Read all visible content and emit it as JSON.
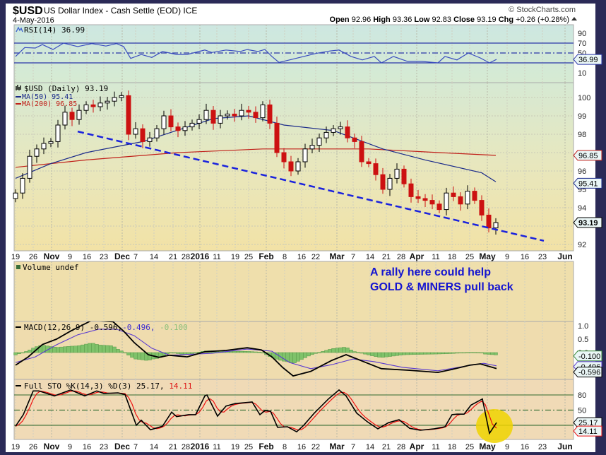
{
  "header": {
    "symbol": "$USD",
    "name": "US Dollar Index - Cash Settle (EOD) ICE",
    "date": "4-May-2016",
    "watermark": "© StockCharts.com",
    "open_label": "Open",
    "open": "92.96",
    "high_label": "High",
    "high": "93.36",
    "low_label": "Low",
    "low": "92.83",
    "close_label": "Close",
    "close": "93.19",
    "chg_label": "Chg",
    "chg": "+0.26 (+0.28%)"
  },
  "panels": {
    "rsi": {
      "label": "RSI(14) 36.99",
      "tag": "36.99"
    },
    "price": {
      "label": "$USD (Daily) 93.19",
      "ma50_label": "MA(50) 95.41",
      "ma200_label": "MA(200) 96.85",
      "close_tag": "93.19",
      "ma50_tag": "95.41",
      "ma200_tag": "96.85"
    },
    "volume": {
      "label": "Volume undef"
    },
    "macd": {
      "label": "MACD(12,26,9) -0.596,",
      "signal": "-0.496,",
      "hist": "-0.100",
      "tags": [
        "-0.100",
        "-0.496",
        "-0.596"
      ]
    },
    "sto": {
      "label": "Full STO %K(14,3) %D(3) 25.17,",
      "d": "14.11",
      "tags": [
        "25.17",
        "14.11"
      ]
    }
  },
  "annotation": {
    "line1": "A rally here could help",
    "line2": "GOLD & MINERS pull back"
  },
  "colors": {
    "frame": "#2b2a57",
    "up": "#000000",
    "down": "#cc1111",
    "ma50": "#1a2a8a",
    "ma200": "#c0201a",
    "trend": "#1a22dd",
    "rsi": "#3a4cc0",
    "macd_hist": "#7fc26a",
    "macd_signal": "#5a3ad0",
    "sto_d": "#ee1111",
    "highlight": "#f0d400",
    "annotation": "#1515d0"
  },
  "chart_data": {
    "type": "candlestick",
    "title": "$USD US Dollar Index - Cash Settle (EOD) ICE",
    "x_unit": "2-trading-day steps from 19-Oct-2015",
    "x_ticks": [
      {
        "k": 0,
        "label": "19"
      },
      {
        "k": 2.5,
        "label": "26"
      },
      {
        "k": 5.1,
        "label": "Nov",
        "major": true
      },
      {
        "k": 7.7,
        "label": "9"
      },
      {
        "k": 10.1,
        "label": "16"
      },
      {
        "k": 12.5,
        "label": "23"
      },
      {
        "k": 15.1,
        "label": "Dec",
        "major": true
      },
      {
        "k": 17,
        "label": "7"
      },
      {
        "k": 19.6,
        "label": "14"
      },
      {
        "k": 22.3,
        "label": "21"
      },
      {
        "k": 24.1,
        "label": "28"
      },
      {
        "k": 26.1,
        "label": "2016",
        "major": true
      },
      {
        "k": 28.5,
        "label": "11"
      },
      {
        "k": 31.1,
        "label": "19"
      },
      {
        "k": 33,
        "label": "25"
      },
      {
        "k": 35.5,
        "label": "Feb",
        "major": true
      },
      {
        "k": 38.1,
        "label": "8"
      },
      {
        "k": 40.5,
        "label": "16"
      },
      {
        "k": 42.5,
        "label": "22"
      },
      {
        "k": 45.5,
        "label": "Mar",
        "major": true
      },
      {
        "k": 47.8,
        "label": "7"
      },
      {
        "k": 50.2,
        "label": "14"
      },
      {
        "k": 52.5,
        "label": "21"
      },
      {
        "k": 54.6,
        "label": "28"
      },
      {
        "k": 56.8,
        "label": "Apr",
        "major": true
      },
      {
        "k": 59.5,
        "label": "11"
      },
      {
        "k": 61.8,
        "label": "18"
      },
      {
        "k": 64.3,
        "label": "25"
      },
      {
        "k": 66.8,
        "label": "May",
        "major": true
      },
      {
        "k": 69.6,
        "label": "9"
      },
      {
        "k": 72.1,
        "label": "16"
      },
      {
        "k": 74.6,
        "label": "23"
      },
      {
        "k": 77.8,
        "label": "Jun",
        "major": true
      }
    ],
    "price": {
      "ylim": [
        91.6,
        100.8
      ],
      "y_ticks": [
        92,
        94,
        95,
        96,
        98,
        99,
        100
      ],
      "closes": [
        94.8,
        95.6,
        96.8,
        97.2,
        97.5,
        97.6,
        98.5,
        99.2,
        98.8,
        99.3,
        99.6,
        99.5,
        99.7,
        99.8,
        100.0,
        100.1,
        98.0,
        98.3,
        97.6,
        97.8,
        98.3,
        99.0,
        98.4,
        98.2,
        98.4,
        98.6,
        98.8,
        99.3,
        98.6,
        99.0,
        99.1,
        99.0,
        99.3,
        99.2,
        98.9,
        99.6,
        98.6,
        97.0,
        96.5,
        96.0,
        96.5,
        97.2,
        97.4,
        97.8,
        98.1,
        98.3,
        98.4,
        97.8,
        97.6,
        96.5,
        96.4,
        95.8,
        95.0,
        95.6,
        96.1,
        95.3,
        94.6,
        94.5,
        94.4,
        94.2,
        93.9,
        94.8,
        94.6,
        94.2,
        94.9,
        94.4,
        93.6,
        92.9,
        93.19
      ],
      "ma50": [
        [
          0,
          95.6
        ],
        [
          5,
          96.4
        ],
        [
          10,
          97.0
        ],
        [
          18,
          97.6
        ],
        [
          28,
          98.85
        ],
        [
          33,
          99.0
        ],
        [
          38,
          98.5
        ],
        [
          45,
          98.2
        ],
        [
          52,
          97.2
        ],
        [
          58,
          96.6
        ],
        [
          66,
          95.9
        ],
        [
          68,
          95.41
        ]
      ],
      "ma200": [
        [
          0,
          96.2
        ],
        [
          10,
          96.6
        ],
        [
          23,
          97.0
        ],
        [
          35,
          97.2
        ],
        [
          50,
          97.2
        ],
        [
          60,
          97.0
        ],
        [
          68,
          96.85
        ]
      ],
      "trendline": [
        [
          8.8,
          98.15
        ],
        [
          74.8,
          92.2
        ]
      ]
    },
    "rsi": {
      "ylim": [
        0,
        100
      ],
      "levels": [
        70,
        50,
        30
      ],
      "y_ticks": [
        90,
        70,
        50,
        10
      ],
      "points": [
        [
          0,
          43
        ],
        [
          1.3,
          61
        ],
        [
          2.8,
          60
        ],
        [
          3.8,
          67
        ],
        [
          5.3,
          57
        ],
        [
          6.8,
          70
        ],
        [
          8.8,
          63
        ],
        [
          10.8,
          69
        ],
        [
          12.8,
          64
        ],
        [
          14.3,
          69
        ],
        [
          15.3,
          63
        ],
        [
          16.3,
          39
        ],
        [
          17.8,
          47
        ],
        [
          19.3,
          41
        ],
        [
          20.8,
          53
        ],
        [
          22.8,
          47
        ],
        [
          24.3,
          47
        ],
        [
          26.8,
          56
        ],
        [
          27.8,
          51
        ],
        [
          29.8,
          56
        ],
        [
          31.8,
          53
        ],
        [
          32.8,
          57
        ],
        [
          34.3,
          53
        ],
        [
          35.3,
          57
        ],
        [
          36.3,
          43
        ],
        [
          37.3,
          31
        ],
        [
          38.8,
          36
        ],
        [
          40.8,
          43
        ],
        [
          42.5,
          49
        ],
        [
          44.5,
          54
        ],
        [
          45.8,
          56
        ],
        [
          47.5,
          43
        ],
        [
          49.1,
          36
        ],
        [
          50.8,
          43
        ],
        [
          51.8,
          30
        ],
        [
          53.5,
          43
        ],
        [
          55.5,
          33
        ],
        [
          57.5,
          33
        ],
        [
          59.8,
          30
        ],
        [
          60.8,
          43
        ],
        [
          62.5,
          36
        ],
        [
          64.1,
          50
        ],
        [
          65.8,
          40
        ],
        [
          67.1,
          30
        ],
        [
          68.1,
          36.99
        ]
      ]
    },
    "macd": {
      "ylim": [
        -1.0,
        1.2
      ],
      "y_ticks": [
        1.0,
        0.5,
        0.0
      ],
      "macd": [
        [
          0,
          -0.47
        ],
        [
          1.8,
          -0.16
        ],
        [
          3.8,
          0.3
        ],
        [
          5.8,
          0.5
        ],
        [
          7.8,
          0.8
        ],
        [
          10.8,
          1.2
        ],
        [
          13.8,
          1.15
        ],
        [
          15.3,
          0.8
        ],
        [
          16.8,
          0.37
        ],
        [
          18.8,
          -0.08
        ],
        [
          20.3,
          -0.18
        ],
        [
          21.8,
          -0.1
        ],
        [
          24.3,
          -0.16
        ],
        [
          26.8,
          0.03
        ],
        [
          29.8,
          0.08
        ],
        [
          32.8,
          0.18
        ],
        [
          34.8,
          0.1
        ],
        [
          36.3,
          -0.16
        ],
        [
          37.8,
          -0.55
        ],
        [
          39.3,
          -0.87
        ],
        [
          41.8,
          -0.7
        ],
        [
          44.8,
          -0.29
        ],
        [
          46.8,
          -0.08
        ],
        [
          49.3,
          -0.34
        ],
        [
          51.8,
          -0.6
        ],
        [
          55.8,
          -0.66
        ],
        [
          59.8,
          -0.74
        ],
        [
          61.8,
          -0.63
        ],
        [
          64.3,
          -0.47
        ],
        [
          65.8,
          -0.42
        ],
        [
          68.1,
          -0.596
        ]
      ],
      "signal": [
        [
          0,
          -0.37
        ],
        [
          2.8,
          -0.16
        ],
        [
          5.8,
          0.29
        ],
        [
          8.8,
          0.66
        ],
        [
          11.8,
          0.87
        ],
        [
          14.3,
          0.87
        ],
        [
          16.8,
          0.63
        ],
        [
          19.3,
          0.16
        ],
        [
          21.8,
          -0.1
        ],
        [
          27.8,
          -0.03
        ],
        [
          32.8,
          0.13
        ],
        [
          36.3,
          0.05
        ],
        [
          38.8,
          -0.37
        ],
        [
          41.8,
          -0.6
        ],
        [
          44.8,
          -0.45
        ],
        [
          47.8,
          -0.24
        ],
        [
          50.8,
          -0.34
        ],
        [
          54.8,
          -0.55
        ],
        [
          59.8,
          -0.68
        ],
        [
          63.8,
          -0.5
        ],
        [
          66.3,
          -0.4
        ],
        [
          68.1,
          -0.496
        ]
      ]
    },
    "sto": {
      "ylim": [
        0,
        100
      ],
      "levels": [
        80,
        50,
        20
      ],
      "y_ticks": [
        80,
        50
      ],
      "k": [
        [
          0,
          18
        ],
        [
          1.1,
          41
        ],
        [
          2.5,
          88
        ],
        [
          3.3,
          88
        ],
        [
          5.5,
          78
        ],
        [
          7.8,
          90
        ],
        [
          9.8,
          78
        ],
        [
          11.5,
          88
        ],
        [
          12.5,
          83
        ],
        [
          14.5,
          84
        ],
        [
          15.5,
          81
        ],
        [
          17.1,
          20
        ],
        [
          17.8,
          30
        ],
        [
          19.1,
          11
        ],
        [
          20.8,
          18
        ],
        [
          22.1,
          46
        ],
        [
          22.8,
          37
        ],
        [
          24.5,
          41
        ],
        [
          25.5,
          41
        ],
        [
          26.8,
          78
        ],
        [
          27.1,
          80
        ],
        [
          28.6,
          38
        ],
        [
          29.8,
          58
        ],
        [
          31.1,
          63
        ],
        [
          33.5,
          66
        ],
        [
          34.6,
          41
        ],
        [
          35.3,
          49
        ],
        [
          36.1,
          48
        ],
        [
          37.1,
          16
        ],
        [
          38.5,
          17
        ],
        [
          39.8,
          7
        ],
        [
          40.8,
          20
        ],
        [
          42.3,
          44
        ],
        [
          44.3,
          72
        ],
        [
          45.8,
          90
        ],
        [
          46.8,
          78
        ],
        [
          48.3,
          44
        ],
        [
          49.8,
          27
        ],
        [
          51.3,
          13
        ],
        [
          52.8,
          25
        ],
        [
          54.3,
          31
        ],
        [
          55.8,
          14
        ],
        [
          57.3,
          10
        ],
        [
          59.3,
          13
        ],
        [
          60.8,
          17
        ],
        [
          61.8,
          41
        ],
        [
          62.5,
          42
        ],
        [
          63.5,
          42
        ],
        [
          64.5,
          60
        ],
        [
          66.1,
          72
        ],
        [
          67.1,
          4
        ],
        [
          68.1,
          25.17
        ]
      ]
    }
  }
}
